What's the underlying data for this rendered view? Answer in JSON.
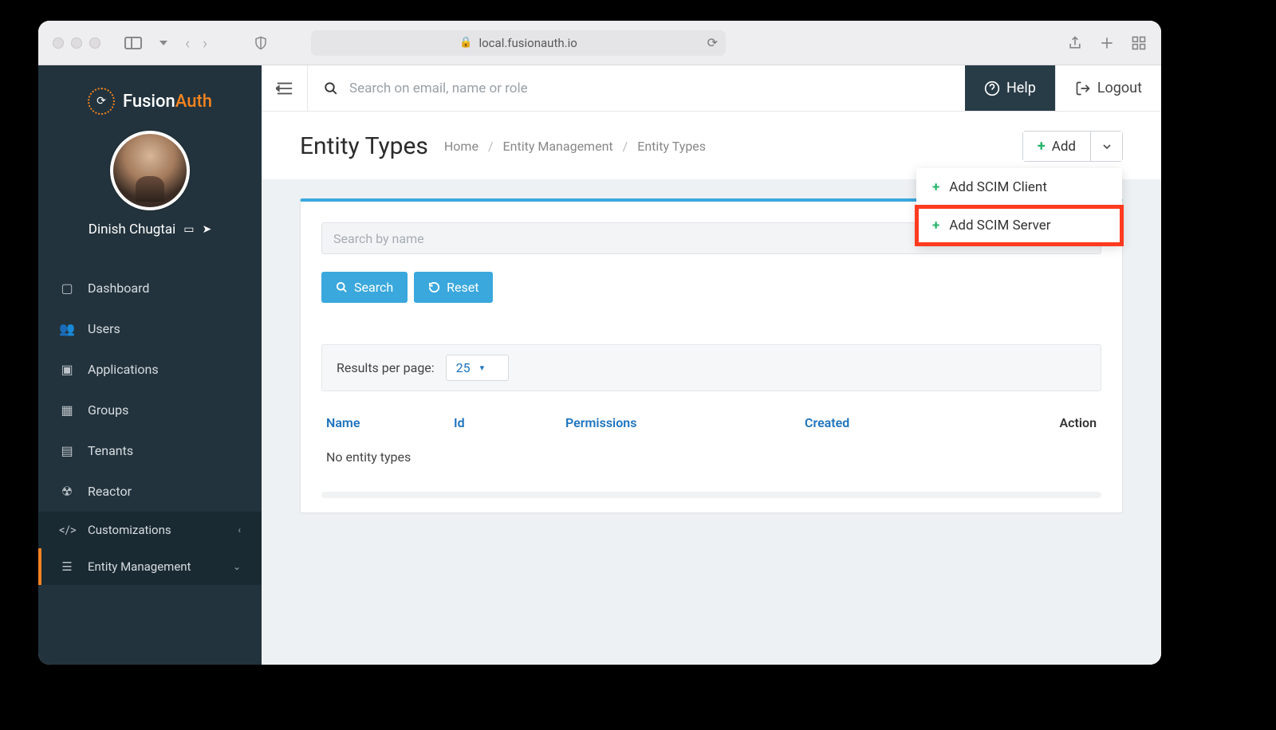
{
  "browser": {
    "url": "local.fusionauth.io"
  },
  "brand": {
    "name_a": "Fusion",
    "name_b": "Auth"
  },
  "user": {
    "name": "Dinish Chugtai"
  },
  "sidebar": {
    "items": [
      {
        "label": "Dashboard"
      },
      {
        "label": "Users"
      },
      {
        "label": "Applications"
      },
      {
        "label": "Groups"
      },
      {
        "label": "Tenants"
      },
      {
        "label": "Reactor"
      }
    ],
    "sections": [
      {
        "label": "Customizations"
      },
      {
        "label": "Entity Management"
      }
    ]
  },
  "topbar": {
    "search_placeholder": "Search on email, name or role",
    "help": "Help",
    "logout": "Logout"
  },
  "page": {
    "title": "Entity Types",
    "breadcrumbs": [
      "Home",
      "Entity Management",
      "Entity Types"
    ],
    "add_label": "Add",
    "dropdown": [
      {
        "label": "Add SCIM Client"
      },
      {
        "label": "Add SCIM Server"
      }
    ]
  },
  "panel": {
    "search_placeholder": "Search by name",
    "search_btn": "Search",
    "reset_btn": "Reset",
    "results_label": "Results per page:",
    "results_value": "25",
    "columns": {
      "name": "Name",
      "id": "Id",
      "permissions": "Permissions",
      "created": "Created",
      "action": "Action"
    },
    "empty": "No entity types"
  }
}
